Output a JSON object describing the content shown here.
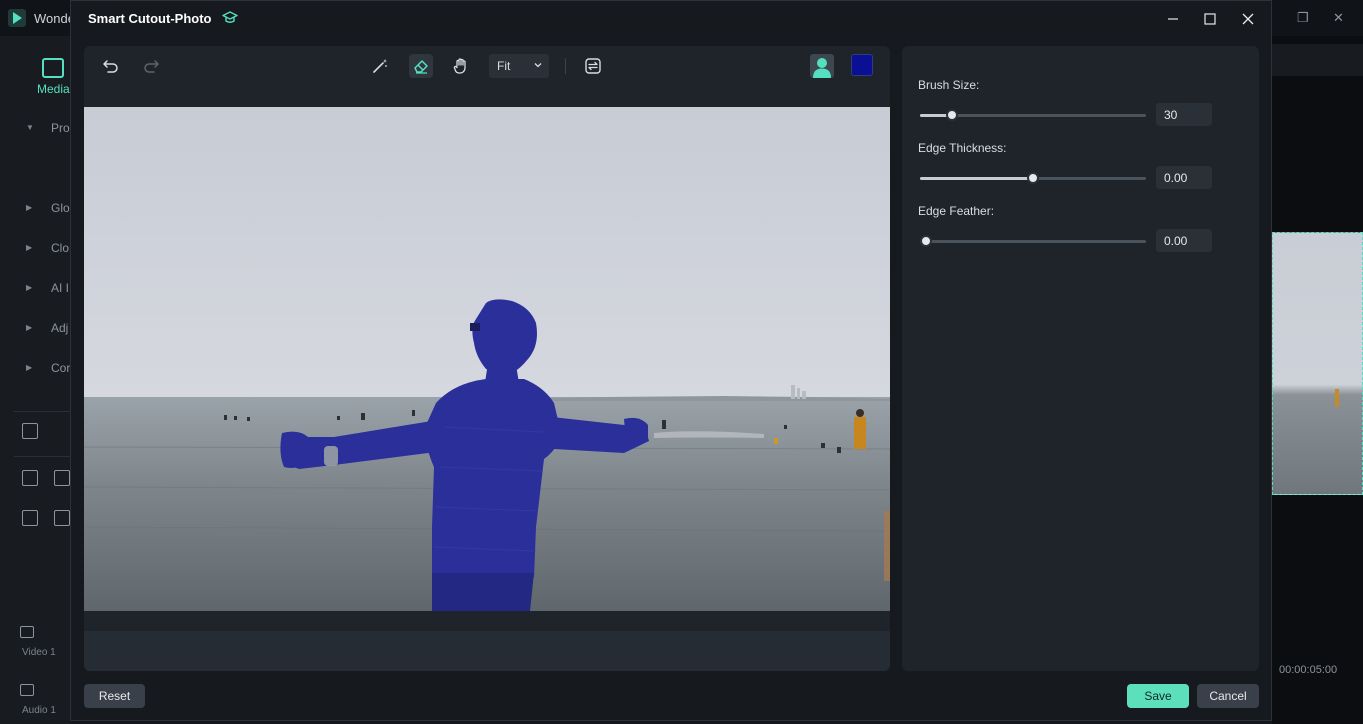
{
  "background_app": {
    "brand": "Wonde",
    "media_tab": "Media",
    "tree_items": [
      "Pro",
      "Glo",
      "Clo",
      "AI I",
      "Adj",
      "Cor"
    ],
    "track_video": "Video 1",
    "track_audio": "Audio 1",
    "timecode": "00:00:05:00"
  },
  "modal": {
    "title": "Smart Cutout-Photo",
    "toolbar": {
      "zoom_value": "Fit",
      "brush_color": "#0a0f94"
    },
    "settings": {
      "brush_size": {
        "label": "Brush Size:",
        "value": "30",
        "fraction": 0.12
      },
      "edge_thickness": {
        "label": "Edge Thickness:",
        "value": "0.00",
        "fraction": 0.5
      },
      "edge_feather": {
        "label": "Edge Feather:",
        "value": "0.00",
        "fraction": 0.0
      }
    },
    "buttons": {
      "reset": "Reset",
      "save": "Save",
      "cancel": "Cancel"
    }
  },
  "colors": {
    "accent": "#5ce0bb",
    "mask_overlay": "#2a2f9a"
  }
}
